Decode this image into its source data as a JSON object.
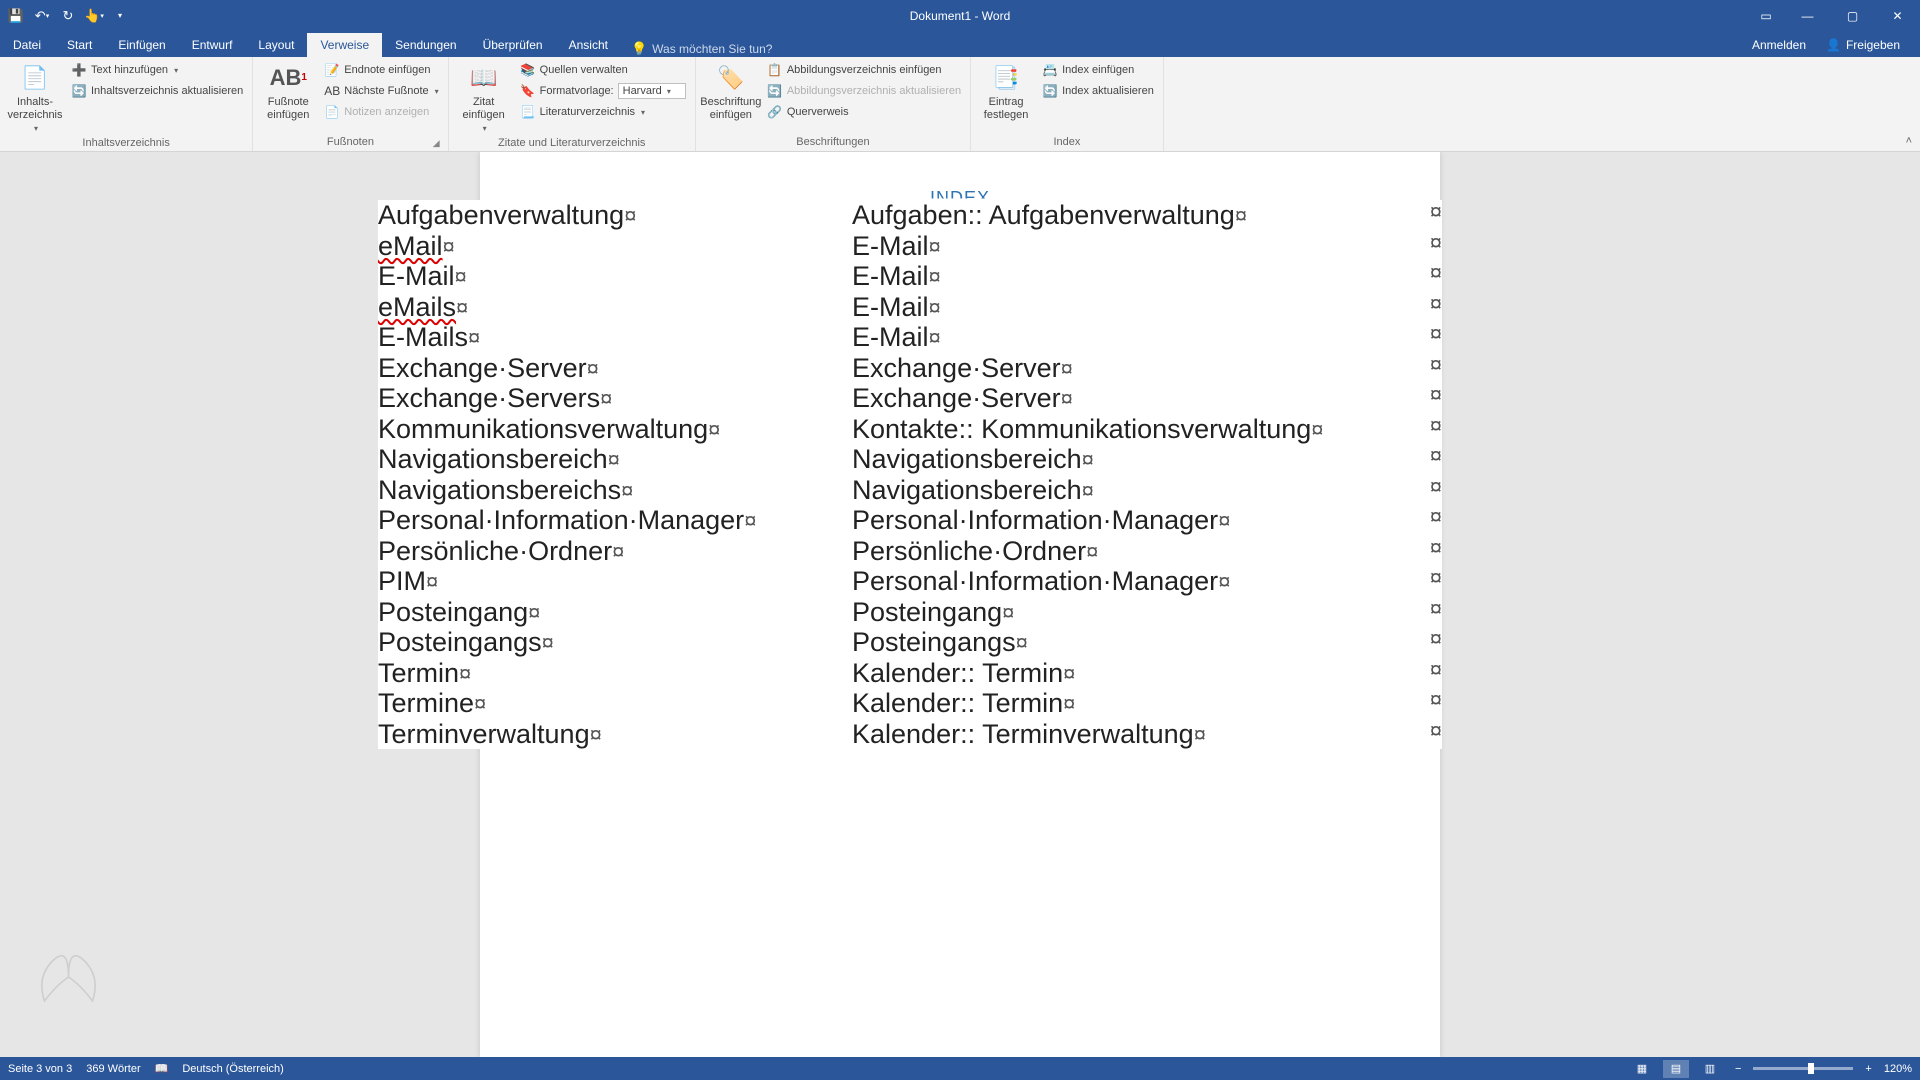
{
  "window": {
    "title": "Dokument1 - Word"
  },
  "qat": {
    "save": "💾",
    "undo": "↶",
    "redo": "↻",
    "touch": "☰"
  },
  "tabs": {
    "file": "Datei",
    "items": [
      "Start",
      "Einfügen",
      "Entwurf",
      "Layout",
      "Verweise",
      "Sendungen",
      "Überprüfen",
      "Ansicht"
    ],
    "active_index": 4,
    "tell_me": "Was möchten Sie tun?",
    "sign_in": "Anmelden",
    "share": "Freigeben"
  },
  "ribbon": {
    "toc": {
      "big": "Inhalts-\nverzeichnis",
      "add_text": "Text hinzufügen",
      "update": "Inhaltsverzeichnis aktualisieren",
      "group": "Inhaltsverzeichnis"
    },
    "footnote": {
      "big": "Fußnote\neinfügen",
      "endnote": "Endnote einfügen",
      "next": "Nächste Fußnote",
      "show": "Notizen anzeigen",
      "group": "Fußnoten"
    },
    "citation": {
      "big": "Zitat\neinfügen",
      "manage": "Quellen verwalten",
      "style_label": "Formatvorlage:",
      "style_value": "Harvard",
      "bib": "Literaturverzeichnis",
      "group": "Zitate und Literaturverzeichnis"
    },
    "caption": {
      "big": "Beschriftung\neinfügen",
      "insert_fig": "Abbildungsverzeichnis einfügen",
      "update_fig": "Abbildungsverzeichnis aktualisieren",
      "crossref": "Querverweis",
      "group": "Beschriftungen"
    },
    "index": {
      "big": "Eintrag\nfestlegen",
      "insert": "Index einfügen",
      "update": "Index aktualisieren",
      "group": "Index"
    }
  },
  "document": {
    "index_title": "INDEX",
    "mark": "¤",
    "dot": "·",
    "colons": "::",
    "rows": [
      {
        "l": "Aufgabenverwaltung",
        "r": "Aufgaben:: Aufgabenverwaltung"
      },
      {
        "l": "eMail",
        "r": "E-Mail",
        "squiggle_l": true
      },
      {
        "l": "E-Mail",
        "r": "E-Mail"
      },
      {
        "l": "eMails",
        "r": "E-Mail",
        "squiggle_l": true
      },
      {
        "l": "E-Mails",
        "r": "E-Mail"
      },
      {
        "l": "Exchange·Server",
        "r": "Exchange·Server"
      },
      {
        "l": "Exchange·Servers",
        "r": "Exchange·Server"
      },
      {
        "l": "Kommunikationsverwaltung",
        "r": "Kontakte:: Kommunikationsverwaltung"
      },
      {
        "l": "Navigationsbereich",
        "r": "Navigationsbereich"
      },
      {
        "l": "Navigationsbereichs",
        "r": "Navigationsbereich"
      },
      {
        "l": "Personal·Information·Manager",
        "r": "Personal·Information·Manager"
      },
      {
        "l": "Persönliche·Ordner",
        "r": "Persönliche·Ordner"
      },
      {
        "l": "PIM",
        "r": "Personal·Information·Manager"
      },
      {
        "l": "Posteingang",
        "r": "Posteingang"
      },
      {
        "l": "Posteingangs",
        "r": "Posteingangs"
      },
      {
        "l": "Termin",
        "r": "Kalender:: Termin"
      },
      {
        "l": "Termine",
        "r": "Kalender:: Termin"
      },
      {
        "l": "Terminverwaltung",
        "r": "Kalender:: Terminverwaltung"
      }
    ]
  },
  "status": {
    "page": "Seite 3 von 3",
    "words": "369 Wörter",
    "lang": "Deutsch (Österreich)",
    "zoom": "120%"
  }
}
